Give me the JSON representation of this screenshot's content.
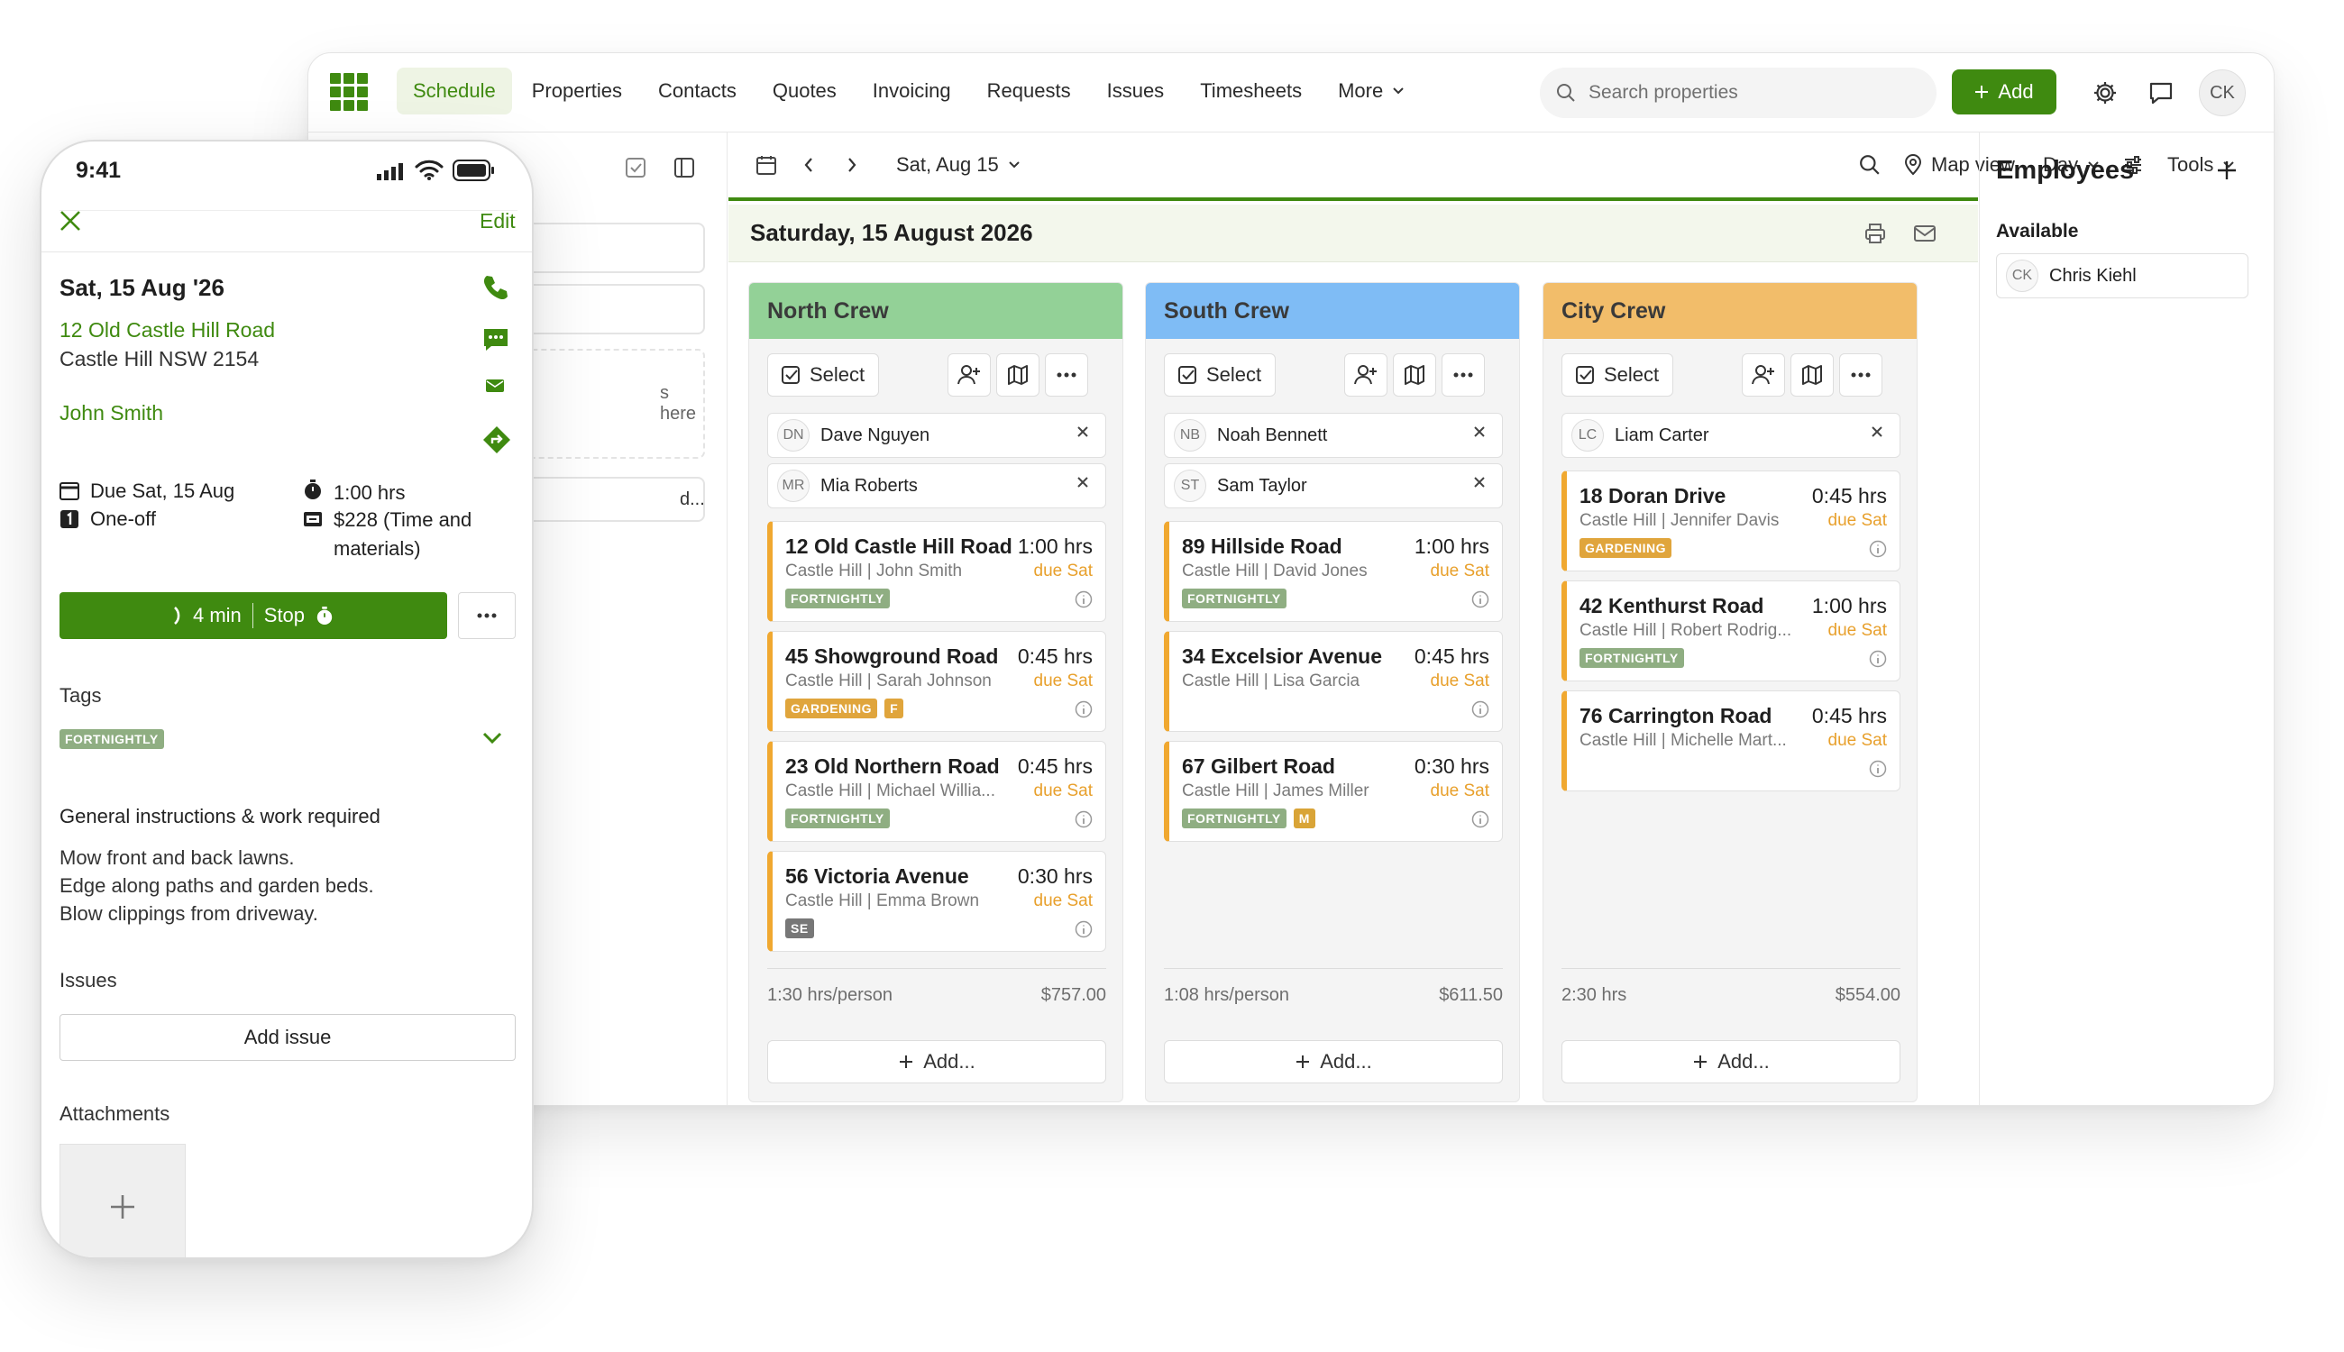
{
  "desktop": {
    "nav": {
      "tabs": [
        "Schedule",
        "Properties",
        "Contacts",
        "Quotes",
        "Invoicing",
        "Requests",
        "Issues",
        "Timesheets",
        "More"
      ],
      "active_tab": "Schedule",
      "search_placeholder": "Search properties",
      "add_label": "Add",
      "avatar_initials": "CK"
    },
    "left_pane": {
      "drop_hint": "s here",
      "add_partial": "d..."
    },
    "toolbar": {
      "date_label": "Sat, Aug 15",
      "map_view": "Map view",
      "view_mode": "Day",
      "tools": "Tools"
    },
    "date_heading": "Saturday, 15 August 2026",
    "crews": [
      {
        "name": "North Crew",
        "color": "#93d197",
        "select_label": "Select",
        "employees": [
          {
            "initials": "DN",
            "name": "Dave Nguyen"
          },
          {
            "initials": "MR",
            "name": "Mia Roberts"
          }
        ],
        "jobs": [
          {
            "address": "12 Old Castle Hill Road",
            "hours": "1:00 hrs",
            "subtitle": "Castle Hill | John Smith",
            "due": "due Sat",
            "tags": [
              {
                "text": "FORTNIGHTLY",
                "color": "#8fae82"
              }
            ]
          },
          {
            "address": "45 Showground Road",
            "hours": "0:45 hrs",
            "subtitle": "Castle Hill | Sarah Johnson",
            "due": "due Sat",
            "tags": [
              {
                "text": "GARDENING",
                "color": "#e0a53c"
              },
              {
                "text": "F",
                "color": "#e0a53c"
              }
            ]
          },
          {
            "address": "23 Old Northern Road",
            "hours": "0:45 hrs",
            "subtitle": "Castle Hill | Michael Willia...",
            "due": "due Sat",
            "tags": [
              {
                "text": "FORTNIGHTLY",
                "color": "#8fae82"
              }
            ]
          },
          {
            "address": "56 Victoria Avenue",
            "hours": "0:30 hrs",
            "subtitle": "Castle Hill | Emma Brown",
            "due": "due Sat",
            "tags": [
              {
                "text": "SE",
                "color": "#777777"
              }
            ]
          }
        ],
        "footer_hours": "1:30 hrs/person",
        "footer_amount": "$757.00",
        "add_label": "Add..."
      },
      {
        "name": "South Crew",
        "color": "#7fbcf5",
        "select_label": "Select",
        "employees": [
          {
            "initials": "NB",
            "name": "Noah Bennett"
          },
          {
            "initials": "ST",
            "name": "Sam Taylor"
          }
        ],
        "jobs": [
          {
            "address": "89 Hillside Road",
            "hours": "1:00 hrs",
            "subtitle": "Castle Hill | David Jones",
            "due": "due Sat",
            "tags": [
              {
                "text": "FORTNIGHTLY",
                "color": "#8fae82"
              }
            ]
          },
          {
            "address": "34 Excelsior Avenue",
            "hours": "0:45 hrs",
            "subtitle": "Castle Hill | Lisa Garcia",
            "due": "due Sat",
            "tags": []
          },
          {
            "address": "67 Gilbert Road",
            "hours": "0:30 hrs",
            "subtitle": "Castle Hill | James Miller",
            "due": "due Sat",
            "tags": [
              {
                "text": "FORTNIGHTLY",
                "color": "#8fae82"
              },
              {
                "text": "M",
                "color": "#d9a437"
              }
            ]
          }
        ],
        "footer_hours": "1:08 hrs/person",
        "footer_amount": "$611.50",
        "add_label": "Add..."
      },
      {
        "name": "City Crew",
        "color": "#f2bd6a",
        "select_label": "Select",
        "employees": [
          {
            "initials": "LC",
            "name": "Liam Carter"
          }
        ],
        "jobs": [
          {
            "address": "18 Doran Drive",
            "hours": "0:45 hrs",
            "subtitle": "Castle Hill | Jennifer Davis",
            "due": "due Sat",
            "tags": [
              {
                "text": "GARDENING",
                "color": "#e0a53c"
              }
            ]
          },
          {
            "address": "42 Kenthurst Road",
            "hours": "1:00 hrs",
            "subtitle": "Castle Hill | Robert Rodrig...",
            "due": "due Sat",
            "tags": [
              {
                "text": "FORTNIGHTLY",
                "color": "#8fae82"
              }
            ]
          },
          {
            "address": "76 Carrington Road",
            "hours": "0:45 hrs",
            "subtitle": "Castle Hill | Michelle Mart...",
            "due": "due Sat",
            "tags": []
          }
        ],
        "footer_hours": "2:30 hrs",
        "footer_amount": "$554.00",
        "add_label": "Add..."
      }
    ],
    "employees_panel": {
      "title": "Employees",
      "section": "Available",
      "items": [
        {
          "initials": "CK",
          "name": "Chris Kiehl"
        }
      ]
    }
  },
  "phone": {
    "time": "9:41",
    "edit_label": "Edit",
    "date": "Sat, 15 Aug '26",
    "address_line1": "12 Old Castle Hill Road",
    "address_line2": "Castle Hill NSW 2154",
    "contact": "John Smith",
    "due": "Due Sat, 15 Aug",
    "duration": "1:00 hrs",
    "frequency": "One-off",
    "price_line1": "$228 (Time and",
    "price_line2": "materials)",
    "timer": "4 min",
    "stop_label": "Stop",
    "tags_heading": "Tags",
    "tag": "FORTNIGHTLY",
    "instructions_heading": "General instructions & work required",
    "instructions": [
      "Mow front and back lawns.",
      "Edge along paths and garden beds.",
      "Blow clippings from driveway."
    ],
    "issues_heading": "Issues",
    "add_issue": "Add issue",
    "attachments_heading": "Attachments"
  },
  "colors": {
    "brand_green": "#3f8a10",
    "due_orange": "#e8a02c"
  }
}
